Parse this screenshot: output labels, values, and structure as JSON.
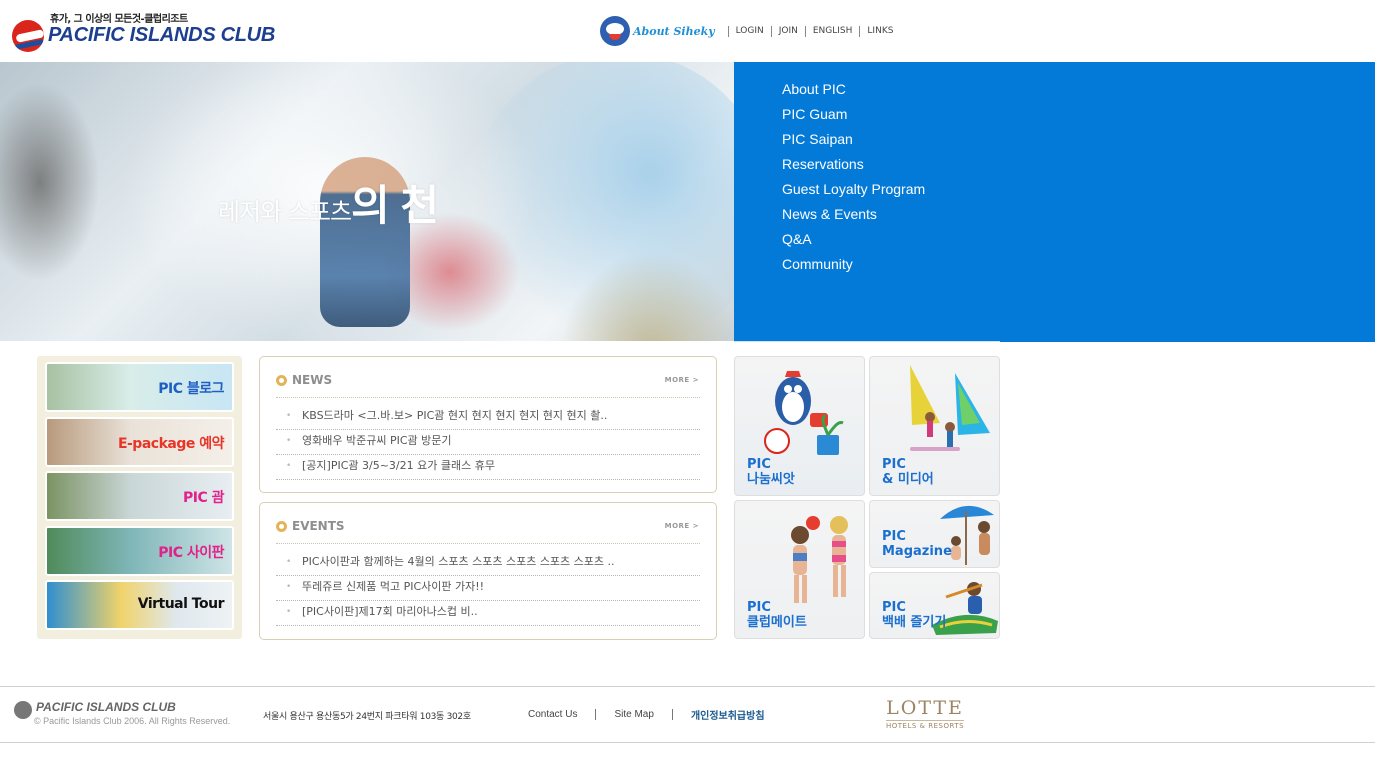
{
  "header": {
    "tagline": "휴가, 그 이상의 모든것-클럽리조트",
    "brand": "PACIFIC ISLANDS CLUB",
    "about_label": "About Siheky",
    "nav": [
      "LOGIN",
      "JOIN",
      "ENGLISH",
      "LINKS"
    ]
  },
  "hero": {
    "copy_small": "레저와 스포츠",
    "copy_big": "의 천"
  },
  "menu": {
    "items": [
      "About PIC",
      "PIC Guam",
      "PIC Saipan",
      "Reservations",
      "Guest Loyalty Program",
      "News & Events",
      "Q&A",
      "Community"
    ]
  },
  "quick_links": [
    {
      "label": "PIC 블로그"
    },
    {
      "label": "E-package 예약"
    },
    {
      "label": "PIC 괌"
    },
    {
      "label": "PIC 사이판"
    },
    {
      "label": "Virtual Tour"
    }
  ],
  "news": {
    "title": "NEWS",
    "more": "MORE >",
    "items": [
      "KBS드라마 <그.바.보> PIC괌 현지 현지 현지 현지 현지 현지 촬..",
      "영화배우 박준규씨 PIC괌 방문기",
      "[공지]PIC괌 3/5~3/21 요가 클래스 휴무"
    ]
  },
  "events": {
    "title": "EVENTS",
    "more": "MORE >",
    "items": [
      "PIC사이판과 함께하는 4월의 스포츠 스포츠  스포츠 스포츠  스포츠 ..",
      "뚜레쥬르 신제품 먹고 PIC사이판 가자!!",
      "[PIC사이판]제17회 마리아나스컵 비.."
    ]
  },
  "tiles": {
    "t1": [
      "PIC",
      "나눔씨앗"
    ],
    "t2": [
      "PIC",
      "& 미디어"
    ],
    "t3": [
      "PIC",
      "클럽메이트"
    ],
    "t4": [
      "PIC",
      "Magazine"
    ],
    "t5": [
      "PIC",
      "백배 즐기기"
    ],
    "tile_color": "#1a6fcf"
  },
  "footer": {
    "brand": "PACIFIC ISLANDS CLUB",
    "copyright": "© Pacific Islands Club 2006. All Rights Reserved.",
    "address": "서울시 용산구 용산동5가 24번지 파크타워 103동 302호",
    "links": [
      "Contact Us",
      "Site Map",
      "개인정보취급방침"
    ],
    "lotte_main": "LOTTE",
    "lotte_sub": "HOTELS & RESORTS"
  },
  "colors": {
    "menu_bg": "#037ad8",
    "brand_blue": "#1d3f8f",
    "brand_red": "#d9251c"
  }
}
